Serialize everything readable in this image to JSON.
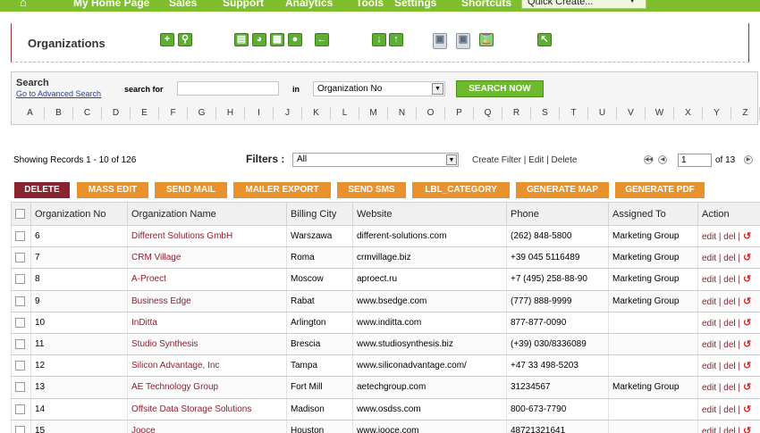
{
  "nav": {
    "items": [
      "My Home Page",
      "Sales",
      "Support",
      "Analytics",
      "Tools",
      "Settings",
      "Shortcuts"
    ],
    "quick_create": "Quick Create..."
  },
  "module": {
    "title": "Organizations"
  },
  "search": {
    "title": "Search",
    "advanced_link": "Go to Advanced Search",
    "search_for_label": "search for",
    "search_for_value": "",
    "in_label": "in",
    "field_value": "Organization No",
    "button": "SEARCH NOW",
    "alphabet": [
      "A",
      "B",
      "C",
      "D",
      "E",
      "F",
      "G",
      "H",
      "I",
      "J",
      "K",
      "L",
      "M",
      "N",
      "O",
      "P",
      "Q",
      "R",
      "S",
      "T",
      "U",
      "V",
      "W",
      "X",
      "Y",
      "Z"
    ]
  },
  "list": {
    "records_text": "Showing Records 1 - 10 of 126",
    "filters_label": "Filters :",
    "filter_value": "All",
    "filter_actions": "Create Filter | Edit | Delete",
    "page_value": "1",
    "page_of": "of 13"
  },
  "actions": [
    "DELETE",
    "MASS EDIT",
    "SEND MAIL",
    "MAILER EXPORT",
    "SEND SMS",
    "LBL_CATEGORY",
    "GENERATE MAP",
    "GENERATE PDF"
  ],
  "table": {
    "headers": [
      "Organization No",
      "Organization Name",
      "Billing City",
      "Website",
      "Phone",
      "Assigned To",
      "Action"
    ],
    "action_text": "edit | del |",
    "rows": [
      [
        "6",
        "Different Solutions GmbH",
        "Warszawa",
        "different-solutions.com",
        "(262) 848-5800",
        "Marketing Group"
      ],
      [
        "7",
        "CRM Village",
        "Roma",
        "crmvillage.biz",
        "+39 045 5116489",
        "Marketing Group"
      ],
      [
        "8",
        "A-Proect",
        "Moscow",
        "aproect.ru",
        "+7 (495) 258-88-90",
        "Marketing Group"
      ],
      [
        "9",
        "Business Edge",
        "Rabat",
        "www.bsedge.com",
        "(777) 888-9999",
        "Marketing Group"
      ],
      [
        "10",
        "InDitta",
        "Arlington",
        "www.inditta.com",
        "877-877-0090",
        ""
      ],
      [
        "11",
        "Studio Synthesis",
        "Brescia",
        "www.studiosynthesis.biz",
        "(+39) 030/8336089",
        ""
      ],
      [
        "12",
        "Silicon Advantage, Inc",
        "Tampa",
        "www.siliconadvantage.com/",
        "+47 33 498-5203",
        ""
      ],
      [
        "13",
        "AE Technology Group",
        "Fort Mill",
        "aetechgroup.com",
        "31234567",
        "Marketing Group"
      ],
      [
        "14",
        "Offsite Data Storage Solutions",
        "Madison",
        "www.osdss.com",
        "800-673-7790",
        ""
      ],
      [
        "15",
        "Jooce",
        "Houston",
        "www.jooce.com",
        "48721321641",
        ""
      ]
    ]
  }
}
